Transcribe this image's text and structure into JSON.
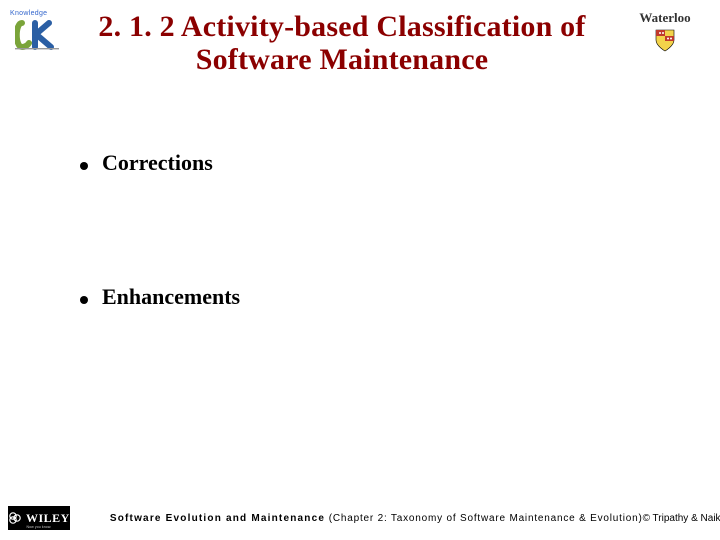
{
  "header": {
    "title": "2. 1. 2 Activity-based Classification of Software Maintenance",
    "left_logo": {
      "top_label": "Knowledge",
      "name": "ck-knowledge-logo"
    },
    "right_logo": {
      "label": "Waterloo",
      "name": "waterloo-logo"
    }
  },
  "bullets": [
    {
      "text": "Corrections"
    },
    {
      "text": "Enhancements"
    }
  ],
  "footer": {
    "publisher_logo": {
      "text": "WILEY",
      "subtext": "Now you know."
    },
    "book_label_bold": "Software Evolution and Maintenance",
    "chapter_text": "  (Chapter 2: Taxonomy of Software Maintenance & Evolution)",
    "copyright": "© Tripathy & Naik"
  }
}
